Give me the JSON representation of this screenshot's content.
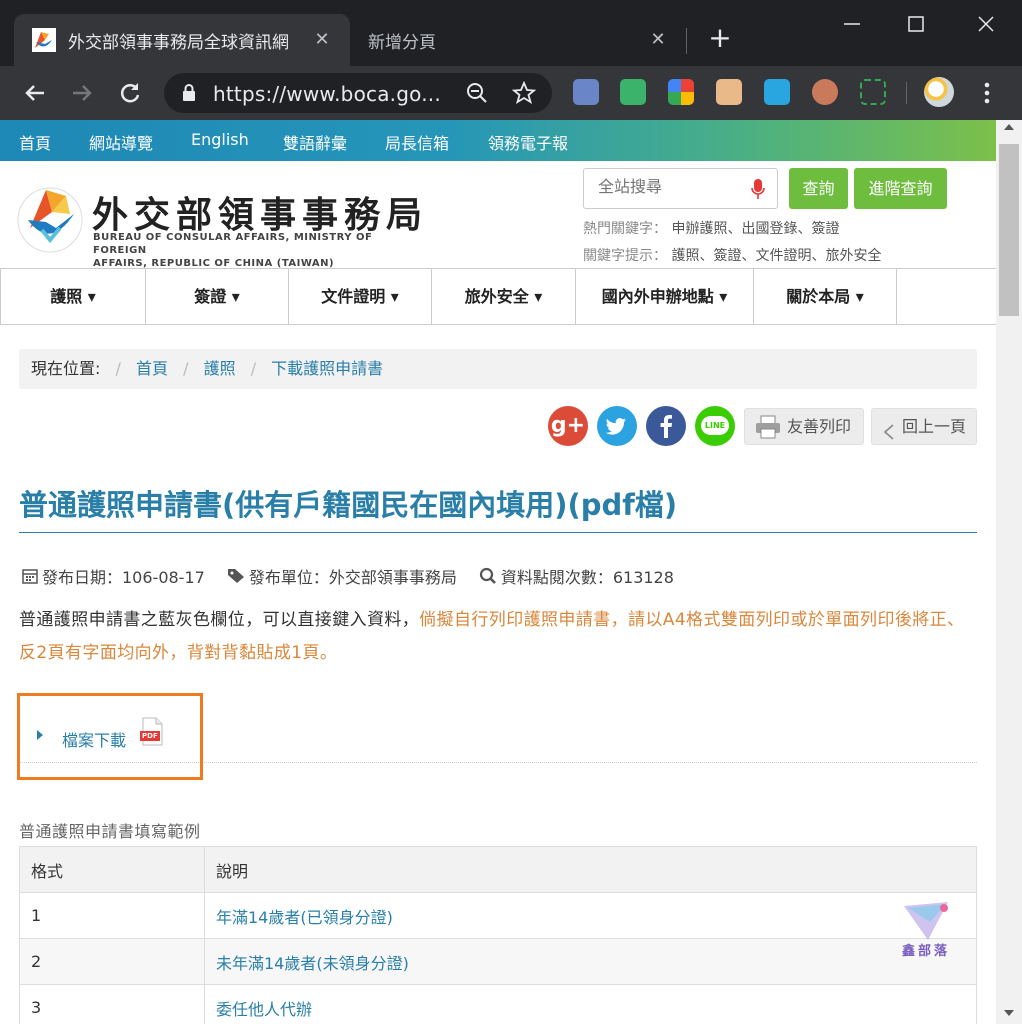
{
  "browser": {
    "active_tab": "外交部領事事務局全球資訊網",
    "second_tab": "新增分頁",
    "new_tab_symbol": "+",
    "close_symbol": "✕",
    "url": "https://www.boca.go..."
  },
  "topbar": {
    "links": [
      "首頁",
      "網站導覽",
      "English",
      "雙語辭彙",
      "局長信箱",
      "領務電子報"
    ]
  },
  "header": {
    "title_cn": "外交部領事事務局",
    "title_en_line1": "BUREAU OF CONSULAR AFFAIRS, MINISTRY OF FOREIGN",
    "title_en_line2": "AFFAIRS, REPUBLIC OF CHINA (TAIWAN)",
    "search_placeholder": "全站搜尋",
    "search_button": "查詢",
    "advanced_button": "進階查詢",
    "hot_label": "熱門關鍵字：",
    "hot_values": "申辦護照、出國登錄、簽證",
    "hint_label": "關鍵字提示：",
    "hint_values": "護照、簽證、文件證明、旅外安全"
  },
  "nav": {
    "items": [
      "護照 ▾",
      "簽證 ▾",
      "文件證明 ▾",
      "旅外安全 ▾",
      "國內外申辦地點 ▾",
      "關於本局 ▾"
    ]
  },
  "breadcrumb": {
    "label": "現在位置:",
    "items": [
      "首頁",
      "護照",
      "下載護照申請書"
    ],
    "separator": "/"
  },
  "share": {
    "print": "友善列印",
    "back": "回上一頁",
    "line_text": "LINE",
    "gplus_text": "g+"
  },
  "article": {
    "title": "普通護照申請書(供有戶籍國民在國內填用)(pdf檔)",
    "date_label": "發布日期：106-08-17",
    "unit_label": "發布單位：外交部領事事務局",
    "views_label": "資料點閱次數：613128",
    "desc_part1": "普通護照申請書之藍灰色欄位，可以直接鍵入資料，",
    "desc_part2": "倘擬自行列印護照申請書，請以A4格式雙面列印或於單面列印後將正、反2頁有字面均向外，背對背黏貼成1頁。",
    "download": "檔案下載",
    "pdf_badge": "PDF"
  },
  "table": {
    "caption": "普通護照申請書填寫範例",
    "headers": [
      "格式",
      "說明"
    ],
    "rows": [
      {
        "n": "1",
        "desc": "年滿14歲者(已領身分證)"
      },
      {
        "n": "2",
        "desc": "未年滿14歲者(未領身分證)"
      },
      {
        "n": "3",
        "desc": "委任他人代辦"
      }
    ]
  },
  "watermark": "鑫部落",
  "colors": {
    "accent": "#2a7fa8",
    "green_button": "#6fbd3f",
    "orange_text": "#d9873b",
    "highlight_box": "#f07c22"
  }
}
